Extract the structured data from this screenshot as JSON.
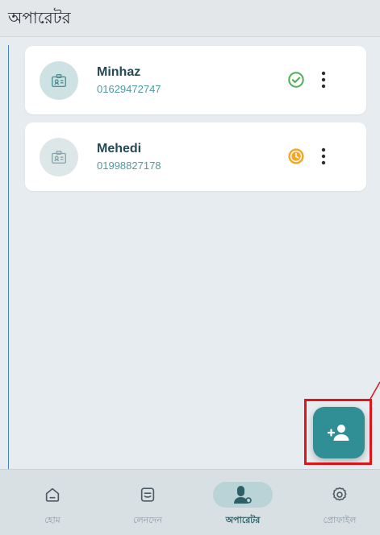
{
  "header": {
    "title": "অপারেটর"
  },
  "operators": [
    {
      "name": "Minhaz",
      "phone": "01629472747",
      "status": "approved",
      "status_icon": "check-circle-icon",
      "status_color": "#4caf50"
    },
    {
      "name": "Mehedi",
      "phone": "01998827178",
      "status": "pending",
      "status_icon": "clock-icon",
      "status_color": "#f5a623"
    }
  ],
  "fab": {
    "icon": "add-person-icon",
    "color": "#2f8f94"
  },
  "bottom_nav": {
    "items": [
      {
        "label": "হোম",
        "icon": "home-icon"
      },
      {
        "label": "লেনদেন",
        "icon": "transactions-icon"
      },
      {
        "label": "অপারেটর",
        "icon": "operator-icon",
        "active": true
      },
      {
        "label": "প্রোফাইল",
        "icon": "settings-gear-icon"
      }
    ]
  },
  "colors": {
    "accent": "#2f8f94",
    "highlight_box": "#e0141b",
    "background": "#e6ecef"
  }
}
